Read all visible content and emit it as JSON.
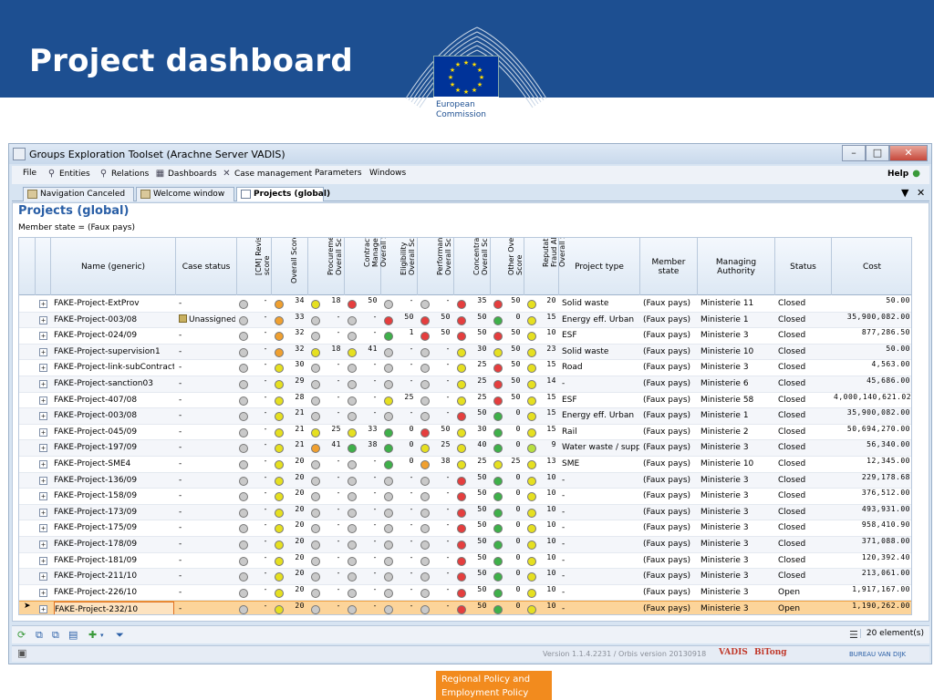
{
  "slide": {
    "title": "Project dashboard",
    "logo_text": "European Commission",
    "footer_text": "Regional Policy and Employment Policy"
  },
  "window": {
    "title": "Groups Exploration Toolset (Arachne Server VADIS)",
    "controls": [
      "–",
      "□",
      "✕"
    ]
  },
  "menu": [
    {
      "label": "File",
      "icon": ""
    },
    {
      "label": "Entities",
      "icon": "search-icon"
    },
    {
      "label": "Relations",
      "icon": "search-icon"
    },
    {
      "label": "Dashboards",
      "icon": "dashboard-icon"
    },
    {
      "label": "Case management",
      "icon": "tools-icon"
    },
    {
      "label": "Parameters",
      "icon": ""
    },
    {
      "label": "Windows",
      "icon": ""
    }
  ],
  "help_label": "Help",
  "tabs": [
    {
      "label": "Navigation Canceled",
      "active": false
    },
    {
      "label": "Welcome window",
      "active": false
    },
    {
      "label": "Projects (global)",
      "active": true
    }
  ],
  "tab_controls": [
    "▼",
    "✕"
  ],
  "view": {
    "title": "Projects (global)",
    "filter": "Member state = (Faux pays)"
  },
  "columns": {
    "name": "Name (generic)",
    "case_status": "Case status",
    "cm_revised": "[CM] Revised\nscore",
    "overall": "Overall Score",
    "procurement": "Procurement\nOverall Score",
    "contract": "Contract\nManagement\nOverall Score",
    "eligibility": "Eligibility\nOverall Score",
    "performance": "Performance\nOverall Score",
    "concentration": "Concentration\nOverall Score",
    "other": "Other Overall\nScore",
    "reputational": "Reputational\nFraud Alerts\nOverall Score",
    "project_type": "Project type",
    "member_state": "Member state",
    "managing_authority": "Managing Authority",
    "status": "Status",
    "cost": "Cost"
  },
  "colors": {
    "G": "#c9c9c9",
    "Y": "#e6e020",
    "O": "#f0a030",
    "R": "#e53e3e",
    "N": "#3fb04a",
    "L": "#b8e040",
    "selected_row": "#fcd49a",
    "header_blue": "#1d4f91",
    "accent_orange": "#f28b1e"
  },
  "rows": [
    {
      "name": "FAKE-Project-ExtProv",
      "case": "-",
      "cm": [
        "G",
        "-"
      ],
      "ov": [
        "O",
        "34"
      ],
      "pr": [
        "Y",
        "18"
      ],
      "cm2": [
        "R",
        "50"
      ],
      "el": [
        "G",
        "-"
      ],
      "pe": [
        "G",
        "-"
      ],
      "co": [
        "R",
        "35"
      ],
      "ot": [
        "R",
        "50"
      ],
      "re": [
        "Y",
        "20"
      ],
      "type": "Solid waste",
      "ms": "(Faux pays)",
      "ma": "Ministerie 11",
      "st": "Closed",
      "cost": "50.00"
    },
    {
      "name": "FAKE-Project-003/08",
      "case": "Unassigned",
      "cm": [
        "G",
        "-"
      ],
      "ov": [
        "O",
        "33"
      ],
      "pr": [
        "G",
        "-"
      ],
      "cm2": [
        "G",
        "-"
      ],
      "el": [
        "R",
        "50"
      ],
      "pe": [
        "R",
        "50"
      ],
      "co": [
        "R",
        "50"
      ],
      "ot": [
        "N",
        "0"
      ],
      "re": [
        "Y",
        "15"
      ],
      "type": "Energy eff. Urban",
      "ms": "(Faux pays)",
      "ma": "Ministerie 1",
      "st": "Closed",
      "cost": "35,900,082.00"
    },
    {
      "name": "FAKE-Project-024/09",
      "case": "-",
      "cm": [
        "G",
        "-"
      ],
      "ov": [
        "O",
        "32"
      ],
      "pr": [
        "G",
        "-"
      ],
      "cm2": [
        "G",
        "-"
      ],
      "el": [
        "N",
        "1"
      ],
      "pe": [
        "R",
        "50"
      ],
      "co": [
        "R",
        "50"
      ],
      "ot": [
        "R",
        "50"
      ],
      "re": [
        "Y",
        "10"
      ],
      "type": "ESF",
      "ms": "(Faux pays)",
      "ma": "Ministerie 3",
      "st": "Closed",
      "cost": "877,286.50"
    },
    {
      "name": "FAKE-Project-supervision1",
      "case": "-",
      "cm": [
        "G",
        "-"
      ],
      "ov": [
        "O",
        "32"
      ],
      "pr": [
        "Y",
        "18"
      ],
      "cm2": [
        "Y",
        "41"
      ],
      "el": [
        "G",
        "-"
      ],
      "pe": [
        "G",
        "-"
      ],
      "co": [
        "Y",
        "30"
      ],
      "ot": [
        "Y",
        "50"
      ],
      "re": [
        "Y",
        "23"
      ],
      "type": "Solid waste",
      "ms": "(Faux pays)",
      "ma": "Ministerie 10",
      "st": "Closed",
      "cost": "50.00"
    },
    {
      "name": "FAKE-Project-link-subContractor",
      "case": "-",
      "cm": [
        "G",
        "-"
      ],
      "ov": [
        "Y",
        "30"
      ],
      "pr": [
        "G",
        "-"
      ],
      "cm2": [
        "G",
        "-"
      ],
      "el": [
        "G",
        "-"
      ],
      "pe": [
        "G",
        "-"
      ],
      "co": [
        "Y",
        "25"
      ],
      "ot": [
        "R",
        "50"
      ],
      "re": [
        "Y",
        "15"
      ],
      "type": "Road",
      "ms": "(Faux pays)",
      "ma": "Ministerie 3",
      "st": "Closed",
      "cost": "4,563.00"
    },
    {
      "name": "FAKE-Project-sanction03",
      "case": "-",
      "cm": [
        "G",
        "-"
      ],
      "ov": [
        "Y",
        "29"
      ],
      "pr": [
        "G",
        "-"
      ],
      "cm2": [
        "G",
        "-"
      ],
      "el": [
        "G",
        "-"
      ],
      "pe": [
        "G",
        "-"
      ],
      "co": [
        "Y",
        "25"
      ],
      "ot": [
        "R",
        "50"
      ],
      "re": [
        "Y",
        "14"
      ],
      "type": "-",
      "ms": "(Faux pays)",
      "ma": "Ministerie 6",
      "st": "Closed",
      "cost": "45,686.00"
    },
    {
      "name": "FAKE-Project-407/08",
      "case": "-",
      "cm": [
        "G",
        "-"
      ],
      "ov": [
        "Y",
        "28"
      ],
      "pr": [
        "G",
        "-"
      ],
      "cm2": [
        "G",
        "-"
      ],
      "el": [
        "Y",
        "25"
      ],
      "pe": [
        "G",
        "-"
      ],
      "co": [
        "Y",
        "25"
      ],
      "ot": [
        "R",
        "50"
      ],
      "re": [
        "Y",
        "15"
      ],
      "type": "ESF",
      "ms": "(Faux pays)",
      "ma": "Ministerie 58",
      "st": "Closed",
      "cost": "4,000,140,621.02"
    },
    {
      "name": "FAKE-Project-003/08",
      "case": "-",
      "cm": [
        "G",
        "-"
      ],
      "ov": [
        "Y",
        "21"
      ],
      "pr": [
        "G",
        "-"
      ],
      "cm2": [
        "G",
        "-"
      ],
      "el": [
        "G",
        "-"
      ],
      "pe": [
        "G",
        "-"
      ],
      "co": [
        "R",
        "50"
      ],
      "ot": [
        "N",
        "0"
      ],
      "re": [
        "Y",
        "15"
      ],
      "type": "Energy eff. Urban",
      "ms": "(Faux pays)",
      "ma": "Ministerie 1",
      "st": "Closed",
      "cost": "35,900,082.00"
    },
    {
      "name": "FAKE-Project-045/09",
      "case": "-",
      "cm": [
        "G",
        "-"
      ],
      "ov": [
        "Y",
        "21"
      ],
      "pr": [
        "Y",
        "25"
      ],
      "cm2": [
        "Y",
        "33"
      ],
      "el": [
        "N",
        "0"
      ],
      "pe": [
        "R",
        "50"
      ],
      "co": [
        "Y",
        "30"
      ],
      "ot": [
        "N",
        "0"
      ],
      "re": [
        "Y",
        "15"
      ],
      "type": "Rail",
      "ms": "(Faux pays)",
      "ma": "Ministerie 2",
      "st": "Closed",
      "cost": "50,694,270.00"
    },
    {
      "name": "FAKE-Project-197/09",
      "case": "-",
      "cm": [
        "G",
        "-"
      ],
      "ov": [
        "Y",
        "21"
      ],
      "pr": [
        "O",
        "41"
      ],
      "cm2": [
        "N",
        "38"
      ],
      "el": [
        "N",
        "0"
      ],
      "pe": [
        "Y",
        "25"
      ],
      "co": [
        "Y",
        "40"
      ],
      "ot": [
        "N",
        "0"
      ],
      "re": [
        "L",
        "9"
      ],
      "type": "Water waste / supply",
      "ms": "(Faux pays)",
      "ma": "Ministerie 3",
      "st": "Closed",
      "cost": "56,340.00"
    },
    {
      "name": "FAKE-Project-SME4",
      "case": "-",
      "cm": [
        "G",
        "-"
      ],
      "ov": [
        "Y",
        "20"
      ],
      "pr": [
        "G",
        "-"
      ],
      "cm2": [
        "G",
        "-"
      ],
      "el": [
        "N",
        "0"
      ],
      "pe": [
        "O",
        "38"
      ],
      "co": [
        "Y",
        "25"
      ],
      "ot": [
        "Y",
        "25"
      ],
      "re": [
        "Y",
        "13"
      ],
      "type": "SME",
      "ms": "(Faux pays)",
      "ma": "Ministerie 10",
      "st": "Closed",
      "cost": "12,345.00"
    },
    {
      "name": "FAKE-Project-136/09",
      "case": "-",
      "cm": [
        "G",
        "-"
      ],
      "ov": [
        "Y",
        "20"
      ],
      "pr": [
        "G",
        "-"
      ],
      "cm2": [
        "G",
        "-"
      ],
      "el": [
        "G",
        "-"
      ],
      "pe": [
        "G",
        "-"
      ],
      "co": [
        "R",
        "50"
      ],
      "ot": [
        "N",
        "0"
      ],
      "re": [
        "Y",
        "10"
      ],
      "type": "-",
      "ms": "(Faux pays)",
      "ma": "Ministerie 3",
      "st": "Closed",
      "cost": "229,178.68"
    },
    {
      "name": "FAKE-Project-158/09",
      "case": "-",
      "cm": [
        "G",
        "-"
      ],
      "ov": [
        "Y",
        "20"
      ],
      "pr": [
        "G",
        "-"
      ],
      "cm2": [
        "G",
        "-"
      ],
      "el": [
        "G",
        "-"
      ],
      "pe": [
        "G",
        "-"
      ],
      "co": [
        "R",
        "50"
      ],
      "ot": [
        "N",
        "0"
      ],
      "re": [
        "Y",
        "10"
      ],
      "type": "-",
      "ms": "(Faux pays)",
      "ma": "Ministerie 3",
      "st": "Closed",
      "cost": "376,512.00"
    },
    {
      "name": "FAKE-Project-173/09",
      "case": "-",
      "cm": [
        "G",
        "-"
      ],
      "ov": [
        "Y",
        "20"
      ],
      "pr": [
        "G",
        "-"
      ],
      "cm2": [
        "G",
        "-"
      ],
      "el": [
        "G",
        "-"
      ],
      "pe": [
        "G",
        "-"
      ],
      "co": [
        "R",
        "50"
      ],
      "ot": [
        "N",
        "0"
      ],
      "re": [
        "Y",
        "10"
      ],
      "type": "-",
      "ms": "(Faux pays)",
      "ma": "Ministerie 3",
      "st": "Closed",
      "cost": "493,931.00"
    },
    {
      "name": "FAKE-Project-175/09",
      "case": "-",
      "cm": [
        "G",
        "-"
      ],
      "ov": [
        "Y",
        "20"
      ],
      "pr": [
        "G",
        "-"
      ],
      "cm2": [
        "G",
        "-"
      ],
      "el": [
        "G",
        "-"
      ],
      "pe": [
        "G",
        "-"
      ],
      "co": [
        "R",
        "50"
      ],
      "ot": [
        "N",
        "0"
      ],
      "re": [
        "Y",
        "10"
      ],
      "type": "-",
      "ms": "(Faux pays)",
      "ma": "Ministerie 3",
      "st": "Closed",
      "cost": "958,410.90"
    },
    {
      "name": "FAKE-Project-178/09",
      "case": "-",
      "cm": [
        "G",
        "-"
      ],
      "ov": [
        "Y",
        "20"
      ],
      "pr": [
        "G",
        "-"
      ],
      "cm2": [
        "G",
        "-"
      ],
      "el": [
        "G",
        "-"
      ],
      "pe": [
        "G",
        "-"
      ],
      "co": [
        "R",
        "50"
      ],
      "ot": [
        "N",
        "0"
      ],
      "re": [
        "Y",
        "10"
      ],
      "type": "-",
      "ms": "(Faux pays)",
      "ma": "Ministerie 3",
      "st": "Closed",
      "cost": "371,088.00"
    },
    {
      "name": "FAKE-Project-181/09",
      "case": "-",
      "cm": [
        "G",
        "-"
      ],
      "ov": [
        "Y",
        "20"
      ],
      "pr": [
        "G",
        "-"
      ],
      "cm2": [
        "G",
        "-"
      ],
      "el": [
        "G",
        "-"
      ],
      "pe": [
        "G",
        "-"
      ],
      "co": [
        "R",
        "50"
      ],
      "ot": [
        "N",
        "0"
      ],
      "re": [
        "Y",
        "10"
      ],
      "type": "-",
      "ms": "(Faux pays)",
      "ma": "Ministerie 3",
      "st": "Closed",
      "cost": "120,392.40"
    },
    {
      "name": "FAKE-Project-211/10",
      "case": "-",
      "cm": [
        "G",
        "-"
      ],
      "ov": [
        "Y",
        "20"
      ],
      "pr": [
        "G",
        "-"
      ],
      "cm2": [
        "G",
        "-"
      ],
      "el": [
        "G",
        "-"
      ],
      "pe": [
        "G",
        "-"
      ],
      "co": [
        "R",
        "50"
      ],
      "ot": [
        "N",
        "0"
      ],
      "re": [
        "Y",
        "10"
      ],
      "type": "-",
      "ms": "(Faux pays)",
      "ma": "Ministerie 3",
      "st": "Closed",
      "cost": "213,061.00"
    },
    {
      "name": "FAKE-Project-226/10",
      "case": "-",
      "cm": [
        "G",
        "-"
      ],
      "ov": [
        "Y",
        "20"
      ],
      "pr": [
        "G",
        "-"
      ],
      "cm2": [
        "G",
        "-"
      ],
      "el": [
        "G",
        "-"
      ],
      "pe": [
        "G",
        "-"
      ],
      "co": [
        "R",
        "50"
      ],
      "ot": [
        "N",
        "0"
      ],
      "re": [
        "Y",
        "10"
      ],
      "type": "-",
      "ms": "(Faux pays)",
      "ma": "Ministerie 3",
      "st": "Open",
      "cost": "1,917,167.00"
    },
    {
      "name": "FAKE-Project-232/10",
      "case": "-",
      "cm": [
        "G",
        "-"
      ],
      "ov": [
        "Y",
        "20"
      ],
      "pr": [
        "G",
        "-"
      ],
      "cm2": [
        "G",
        "-"
      ],
      "el": [
        "G",
        "-"
      ],
      "pe": [
        "G",
        "-"
      ],
      "co": [
        "R",
        "50"
      ],
      "ot": [
        "N",
        "0"
      ],
      "re": [
        "Y",
        "10"
      ],
      "type": "-",
      "ms": "(Faux pays)",
      "ma": "Ministerie 3",
      "st": "Open",
      "cost": "1,190,262.00",
      "selected": true
    }
  ],
  "footer": {
    "count": "20 element(s)",
    "version": "Version 1.1.4.2231 / Orbis version 20130918",
    "brands": [
      "VADIS",
      "BiTong",
      "BUREAU VAN DIJK"
    ]
  }
}
